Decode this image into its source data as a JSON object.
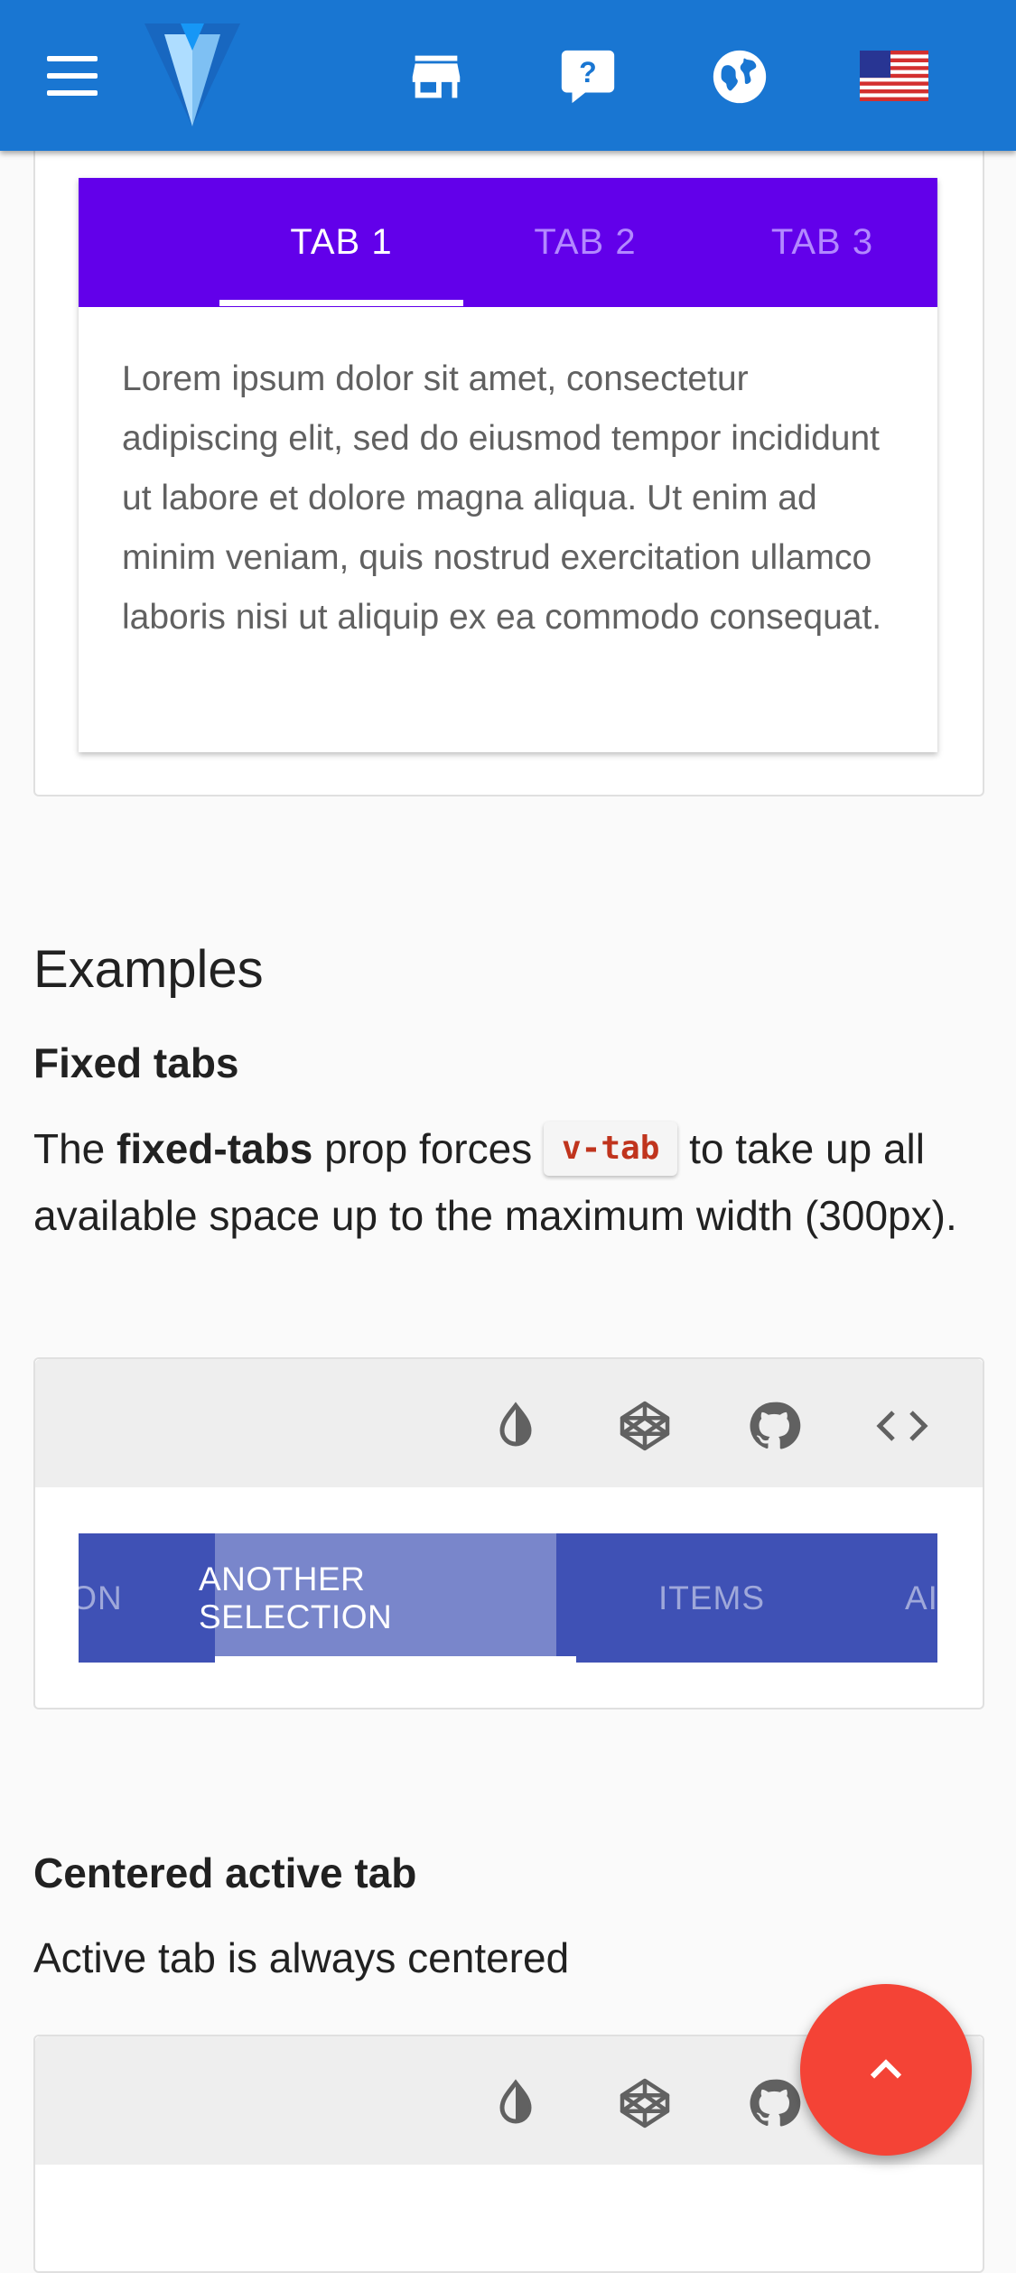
{
  "appbar": {
    "menu_icon": "menu-icon",
    "logo_icon": "vuetify-logo",
    "icons": [
      "store-icon",
      "help-chat-icon",
      "globe-icon",
      "us-flag-icon"
    ]
  },
  "tabs_demo": {
    "tabs": [
      "TAB 1",
      "TAB 2",
      "TAB 3"
    ],
    "active_index": 0,
    "content": "Lorem ipsum dolor sit amet, consectetur adipiscing elit, sed do eiusmod tempor incididunt ut labore et dolore magna aliqua. Ut enim ad minim veniam, quis nostrud exercitation ullamco laboris nisi ut aliquip ex ea commodo consequat.",
    "bar_color": "#6200ea"
  },
  "examples": {
    "heading": "Examples",
    "fixed_tabs": {
      "title": "Fixed tabs",
      "text_before": "The ",
      "prop": "fixed-tabs",
      "text_middle": " prop forces ",
      "code": "v-tab",
      "text_after": " to take up all available space up to the maximum width (300px).",
      "toolbar_icons": [
        "invert-colors-icon",
        "codepen-icon",
        "github-icon",
        "code-brackets-icon"
      ],
      "tabs": [
        "ON",
        "ANOTHER SELECTION",
        "ITEMS",
        "AI"
      ],
      "active_index": 1,
      "bar_color": "#3f51b5"
    },
    "centered_tab": {
      "title": "Centered active tab",
      "description": "Active tab is always centered",
      "toolbar_icons": [
        "invert-colors-icon",
        "codepen-icon",
        "github-icon"
      ]
    }
  },
  "fab": {
    "icon": "chevron-up-icon",
    "color": "#f44336"
  }
}
